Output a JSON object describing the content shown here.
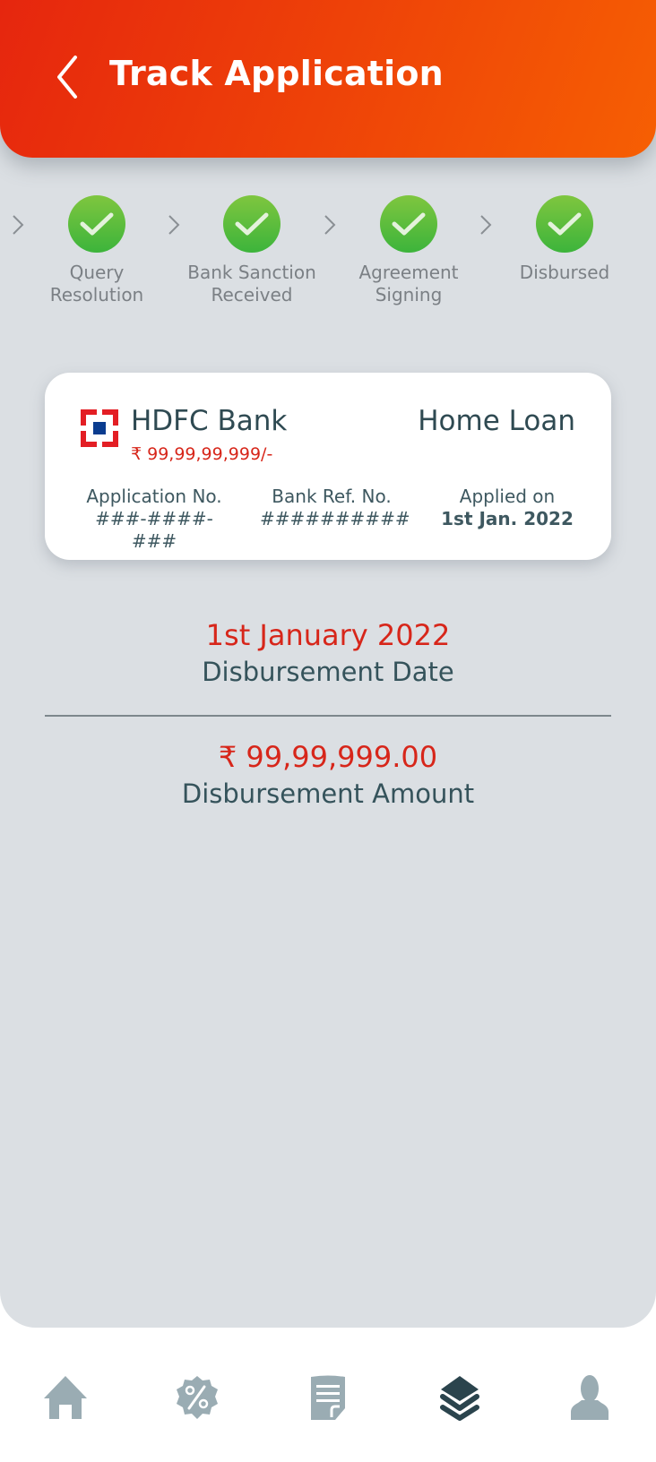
{
  "header": {
    "title": "Track Application",
    "back_icon": "chevron-left-icon"
  },
  "steps": [
    {
      "label_line1": "Query",
      "label_line2": "Resolution",
      "status": "completed"
    },
    {
      "label_line1": "Bank Sanction",
      "label_line2": "Received",
      "status": "completed"
    },
    {
      "label_line1": "Agreement",
      "label_line2": "Signing",
      "status": "completed"
    },
    {
      "label_line1": "Disbursed",
      "label_line2": "",
      "status": "completed"
    }
  ],
  "card": {
    "bank_name": "HDFC Bank",
    "loan_amount": "₹ 99,99,99,999/-",
    "loan_type": "Home Loan",
    "application_no_label": "Application No.",
    "application_no_value": "###-####-###",
    "bank_ref_label": "Bank Ref. No.",
    "bank_ref_value": "##########",
    "applied_on_label": "Applied on",
    "applied_on_value": "1st Jan. 2022"
  },
  "disbursement": {
    "date_value": "1st January 2022",
    "date_label": "Disbursement Date",
    "amount_value": "₹ 99,99,999.00",
    "amount_label": "Disbursement Amount"
  },
  "nav": {
    "items": [
      {
        "icon": "home-icon",
        "active": false
      },
      {
        "icon": "discount-badge-icon",
        "active": false
      },
      {
        "icon": "document-icon",
        "active": false
      },
      {
        "icon": "layers-icon",
        "active": true
      },
      {
        "icon": "user-icon",
        "active": false
      }
    ]
  },
  "colors": {
    "accent_red": "#d7261a",
    "header_start": "#e6260e",
    "header_end": "#f65f03",
    "success_green": "#3cb43b",
    "nav_inactive": "#9aacb3",
    "nav_active": "#2b444d"
  }
}
